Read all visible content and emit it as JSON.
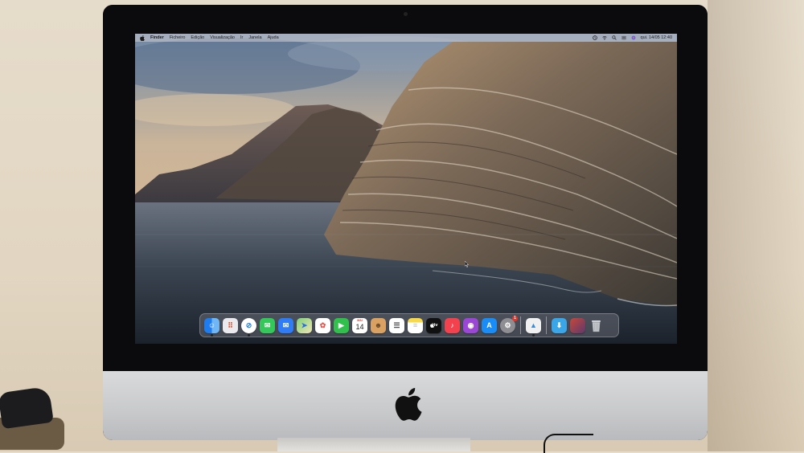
{
  "menubar": {
    "items": [
      "Finder",
      "Ficheiro",
      "Edição",
      "Visualização",
      "Ir",
      "Janela",
      "Ajuda"
    ],
    "datetime": "qui. 14/05  12:40"
  },
  "dock": {
    "apps": [
      {
        "name": "finder-icon",
        "color": "#2a8cf0",
        "glyph": "☺"
      },
      {
        "name": "launchpad-icon",
        "color": "#e9e9ee",
        "glyph": "⠿"
      },
      {
        "name": "safari-icon",
        "color": "#1e7de6",
        "glyph": "⊘"
      },
      {
        "name": "messages-icon",
        "color": "#34c759",
        "glyph": "✉"
      },
      {
        "name": "mail-icon",
        "color": "#2f7cf6",
        "glyph": "✉"
      },
      {
        "name": "maps-icon",
        "color": "#6cc36a",
        "glyph": "➤"
      },
      {
        "name": "photos-icon",
        "color": "#ffffff",
        "glyph": "✿"
      },
      {
        "name": "facetime-icon",
        "color": "#30c04b",
        "glyph": "▶"
      },
      {
        "name": "calendar-icon",
        "color": "#ffffff",
        "glyph": ""
      },
      {
        "name": "contacts-icon",
        "color": "#d9a263",
        "glyph": "☻"
      },
      {
        "name": "reminders-icon",
        "color": "#ffffff",
        "glyph": "☰"
      },
      {
        "name": "notes-icon",
        "color": "#f7d94a",
        "glyph": "≡"
      },
      {
        "name": "tv-icon",
        "color": "#111111",
        "glyph": ""
      },
      {
        "name": "music-icon",
        "color": "#f3424e",
        "glyph": "♪"
      },
      {
        "name": "podcasts-icon",
        "color": "#9b47d6",
        "glyph": "◉"
      },
      {
        "name": "app-store-icon",
        "color": "#1a8cf5",
        "glyph": "A"
      },
      {
        "name": "system-preferences-icon",
        "color": "#8e8e93",
        "glyph": "⚙"
      }
    ],
    "calendar_month": "MAI",
    "calendar_day": "14",
    "tv_label": "tv",
    "system_prefs_badge": "1",
    "extra": [
      {
        "name": "preview-icon",
        "color": "#f0f0f0",
        "glyph": "▲"
      },
      {
        "name": "downloads-folder-icon",
        "color": "#3aa6e8",
        "glyph": "⬇"
      },
      {
        "name": "recent-items-stack-icon",
        "color": "#7a4b3a",
        "glyph": ""
      },
      {
        "name": "trash-icon",
        "color": "#bfc3c8",
        "glyph": "🗑"
      }
    ]
  }
}
